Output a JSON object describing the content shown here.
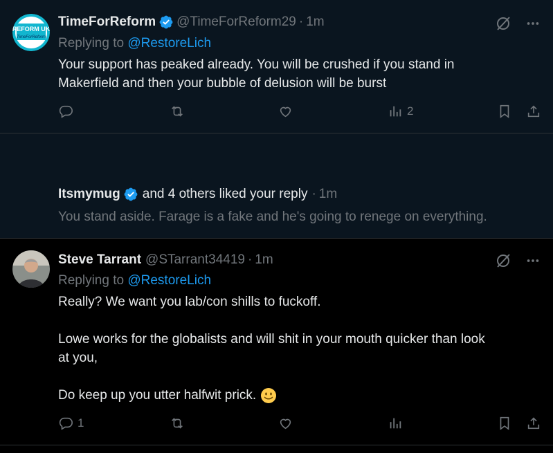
{
  "tweet1": {
    "name": "TimeForReform",
    "handle": "@TimeForReform29",
    "sep": "·",
    "time": "1m",
    "replying_prefix": "Replying to ",
    "replying_to": "@RestoreLich",
    "avatar_text": "REFORM UK",
    "avatar_sub": "TimeForReform",
    "lines": [
      "Your support has peaked already. You will be crushed if you stand in",
      "Makerfield and then your bubble of delusion will be burst"
    ],
    "views": "2"
  },
  "notification": {
    "liker_name": "Itsmymug",
    "liked_text": "and 4 others liked your reply",
    "sep": "·",
    "time": "1m",
    "quote": "You stand aside. Farage is a fake and he's going to renege on everything."
  },
  "tweet2": {
    "name": "Steve Tarrant",
    "handle": "@STarrant34419",
    "sep": "·",
    "time": "1m",
    "replying_prefix": "Replying to ",
    "replying_to": "@RestoreLich",
    "p1": "Really? We want you lab/con shills to fuckoff.",
    "p2a": "Lowe works for the globalists and will shit in your mouth quicker than look",
    "p2b": "at you,",
    "p3": "Do keep up you utter halfwit prick.",
    "replies": "1"
  },
  "colors": {
    "accent": "#1d9bf0",
    "muted": "#71767b",
    "heart": "#f91880",
    "highlight_bg": "#0a151f"
  }
}
